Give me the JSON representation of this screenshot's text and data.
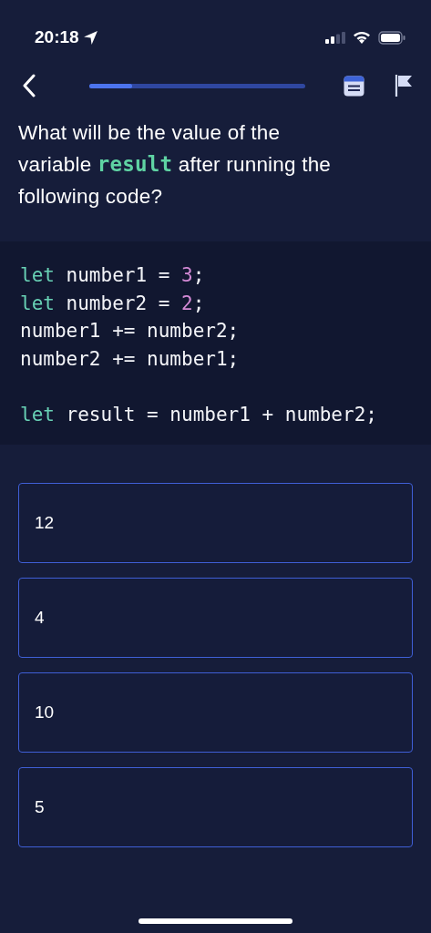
{
  "status_bar": {
    "time": "20:18"
  },
  "progress": {
    "level": 0.2
  },
  "question": [
    {
      "text": "What will be the value of the variable ",
      "kind": "plain"
    },
    {
      "text": "result",
      "kind": "code"
    },
    {
      "text": " after running the following code?",
      "kind": "plain"
    }
  ],
  "code_blocks": [
    {
      "lines": [
        {
          "tokens": [
            {
              "text": "let",
              "kind": "keyword"
            },
            {
              "text": " number1 = ",
              "kind": "plain"
            },
            {
              "text": "3",
              "kind": "number"
            },
            {
              "text": ";",
              "kind": "plain"
            }
          ]
        },
        {
          "tokens": [
            {
              "text": "let",
              "kind": "keyword"
            },
            {
              "text": " number2 = ",
              "kind": "plain"
            },
            {
              "text": "2",
              "kind": "number"
            },
            {
              "text": ";",
              "kind": "plain"
            }
          ]
        },
        {
          "tokens": [
            {
              "text": "number1 += number2;",
              "kind": "plain"
            }
          ]
        },
        {
          "tokens": [
            {
              "text": "number2 += number1;",
              "kind": "plain"
            }
          ]
        }
      ]
    },
    {
      "lines": [
        {
          "tokens": [
            {
              "text": "let",
              "kind": "keyword"
            },
            {
              "text": " result = number1 + number2;",
              "kind": "plain"
            }
          ]
        }
      ]
    }
  ],
  "answers": [
    {
      "label": "12",
      "selected": false
    },
    {
      "label": "4",
      "selected": false
    },
    {
      "label": "10",
      "selected": false
    },
    {
      "label": "5",
      "selected": false
    }
  ]
}
